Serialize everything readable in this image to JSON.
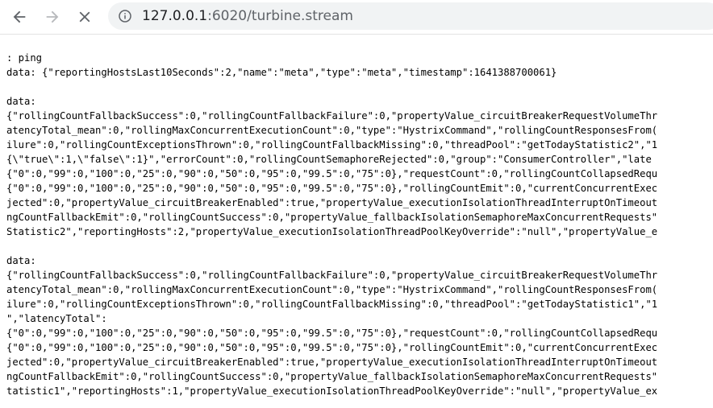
{
  "toolbar": {
    "back_icon": "arrow-left-icon",
    "forward_icon": "arrow-right-icon",
    "stop_icon": "close-icon",
    "info_icon": "info-circle-icon",
    "url_host": "127.0.0.1",
    "url_rest": ":6020/turbine.stream"
  },
  "stream_lines": [
    ": ping",
    "data: {\"reportingHostsLast10Seconds\":2,\"name\":\"meta\",\"type\":\"meta\",\"timestamp\":1641388700061}",
    "",
    "data:",
    "{\"rollingCountFallbackSuccess\":0,\"rollingCountFallbackFailure\":0,\"propertyValue_circuitBreakerRequestVolumeThr",
    "atencyTotal_mean\":0,\"rollingMaxConcurrentExecutionCount\":0,\"type\":\"HystrixCommand\",\"rollingCountResponsesFrom(",
    "ilure\":0,\"rollingCountExceptionsThrown\":0,\"rollingCountFallbackMissing\":0,\"threadPool\":\"getTodayStatistic2\",\"1",
    "{\\\"true\\\":1,\\\"false\\\":1}\",\"errorCount\":0,\"rollingCountSemaphoreRejected\":0,\"group\":\"ConsumerController\",\"late",
    "{\"0\":0,\"99\":0,\"100\":0,\"25\":0,\"90\":0,\"50\":0,\"95\":0,\"99.5\":0,\"75\":0},\"requestCount\":0,\"rollingCountCollapsedRequ",
    "{\"0\":0,\"99\":0,\"100\":0,\"25\":0,\"90\":0,\"50\":0,\"95\":0,\"99.5\":0,\"75\":0},\"rollingCountEmit\":0,\"currentConcurrentExec",
    "jected\":0,\"propertyValue_circuitBreakerEnabled\":true,\"propertyValue_executionIsolationThreadInterruptOnTimeout",
    "ngCountFallbackEmit\":0,\"rollingCountSuccess\":0,\"propertyValue_fallbackIsolationSemaphoreMaxConcurrentRequests\"",
    "Statistic2\",\"reportingHosts\":2,\"propertyValue_executionIsolationThreadPoolKeyOverride\":\"null\",\"propertyValue_e",
    "",
    "data:",
    "{\"rollingCountFallbackSuccess\":0,\"rollingCountFallbackFailure\":0,\"propertyValue_circuitBreakerRequestVolumeThr",
    "atencyTotal_mean\":0,\"rollingMaxConcurrentExecutionCount\":0,\"type\":\"HystrixCommand\",\"rollingCountResponsesFrom(",
    "ilure\":0,\"rollingCountExceptionsThrown\":0,\"rollingCountFallbackMissing\":0,\"threadPool\":\"getTodayStatistic1\",\"1",
    "\",\"latencyTotal\":",
    "{\"0\":0,\"99\":0,\"100\":0,\"25\":0,\"90\":0,\"50\":0,\"95\":0,\"99.5\":0,\"75\":0},\"requestCount\":0,\"rollingCountCollapsedRequ",
    "{\"0\":0,\"99\":0,\"100\":0,\"25\":0,\"90\":0,\"50\":0,\"95\":0,\"99.5\":0,\"75\":0},\"rollingCountEmit\":0,\"currentConcurrentExec",
    "jected\":0,\"propertyValue_circuitBreakerEnabled\":true,\"propertyValue_executionIsolationThreadInterruptOnTimeout",
    "ngCountFallbackEmit\":0,\"rollingCountSuccess\":0,\"propertyValue_fallbackIsolationSemaphoreMaxConcurrentRequests\"",
    "tatistic1\",\"reportingHosts\":1,\"propertyValue_executionIsolationThreadPoolKeyOverride\":\"null\",\"propertyValue_ex"
  ]
}
